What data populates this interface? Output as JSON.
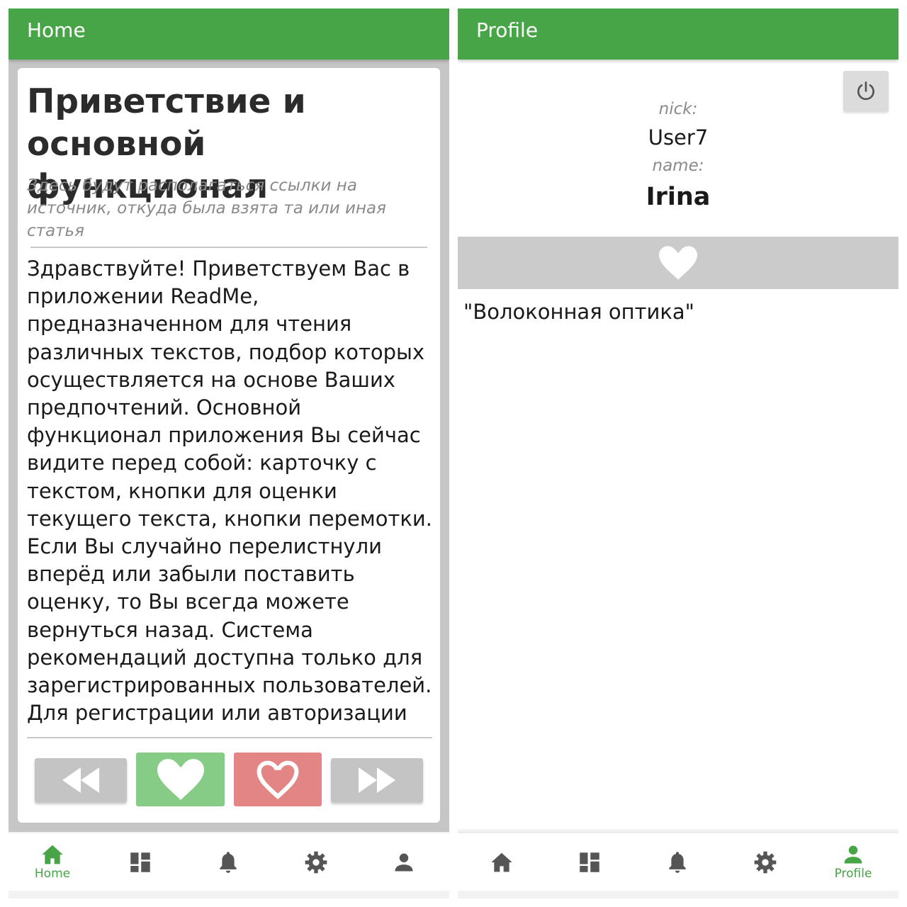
{
  "colors": {
    "accent": "#47a447",
    "like": "#86cb86",
    "dislike": "#e48585",
    "inactive_icon": "#555555"
  },
  "home_screen": {
    "appbar_title": "Home",
    "card": {
      "title": "Приветствие и основной функционал",
      "source": "Здесь будут располагаться ссылки на источник, откуда была взята та или иная статья",
      "body": "Здравствуйте! Приветствуем Вас в приложении ReadMe, предназначенном для чтения различных текстов, подбор которых осуществляется на основе Ваших предпочтений. Основной функционал приложения Вы сейчас видите перед собой: карточку с текстом, кнопки для оценки текущего текста, кнопки перемотки. Если Вы случайно перелистнули вперёд или забыли поставить оценку, то Вы всегда можете вернуться назад. Система рекомендаций доступна только для зарегистрированных пользователей. Для регистрации или авторизации"
    },
    "controls": [
      {
        "name": "rewind",
        "icon": "fast-rewind-icon"
      },
      {
        "name": "like",
        "icon": "heart-filled-icon"
      },
      {
        "name": "dislike",
        "icon": "heart-outline-icon"
      },
      {
        "name": "forward",
        "icon": "fast-forward-icon"
      }
    ],
    "bottom_nav": {
      "active": "home",
      "items": [
        {
          "id": "home",
          "icon": "home-icon",
          "label": "Home"
        },
        {
          "id": "dashboard",
          "icon": "dashboard-icon",
          "label": ""
        },
        {
          "id": "notifications",
          "icon": "bell-icon",
          "label": ""
        },
        {
          "id": "settings",
          "icon": "gear-icon",
          "label": ""
        },
        {
          "id": "profile",
          "icon": "person-icon",
          "label": ""
        }
      ]
    }
  },
  "profile_screen": {
    "appbar_title": "Profile",
    "power_icon": "power-icon",
    "nick_label": "nick:",
    "nick": "User7",
    "name_label": "name:",
    "name": "Irina",
    "favorites_icon": "heart-filled-icon",
    "favorites": [
      "\"Волоконная оптика\""
    ],
    "bottom_nav": {
      "active": "profile",
      "items": [
        {
          "id": "home",
          "icon": "home-icon",
          "label": ""
        },
        {
          "id": "dashboard",
          "icon": "dashboard-icon",
          "label": ""
        },
        {
          "id": "notifications",
          "icon": "bell-icon",
          "label": ""
        },
        {
          "id": "settings",
          "icon": "gear-icon",
          "label": ""
        },
        {
          "id": "profile",
          "icon": "person-icon",
          "label": "Profile"
        }
      ]
    }
  }
}
